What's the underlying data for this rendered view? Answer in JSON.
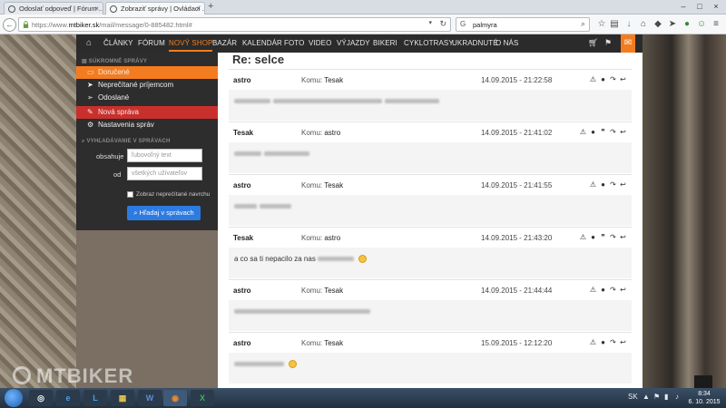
{
  "browser": {
    "tabs": [
      {
        "title": "Odoslať odpoveď | Fórum ..."
      },
      {
        "title": "Zobraziť správy | Ovládací ..."
      }
    ],
    "new_tab": "+",
    "url_prefix": "https://www.",
    "url_domain": "mtbiker.sk",
    "url_path": "/mail/message/0-885482.html#",
    "search_value": "palmyra"
  },
  "site": {
    "nav": [
      "ČLÁNKY",
      "FÓRUM",
      "NOVÝ SHOP",
      "BAZÁR",
      "KALENDÁR",
      "FOTO",
      "VIDEO",
      "VÝJAZDY",
      "BIKERI",
      "CYKLOTRASY",
      "UKRADNUTÉ",
      "O NÁS"
    ],
    "logo": "MTBIKER"
  },
  "sidebar": {
    "section_messages": "SÚKROMNÉ SPRÁVY",
    "items": [
      {
        "label": "Doručené"
      },
      {
        "label": "Neprečítané príjemcom"
      },
      {
        "label": "Odoslané"
      },
      {
        "label": "Nová správa"
      },
      {
        "label": "Nastavenia správ"
      }
    ],
    "section_search": "VYHĽADÁVANIE V SPRÁVACH",
    "contains_label": "obsahuje",
    "contains_placeholder": "ľubovoľný text",
    "from_label": "od",
    "from_placeholder": "všetkých užívateľov",
    "unread_first_label": "Zobraz neprečítané navrchu",
    "search_button": "Hľadaj v správach"
  },
  "main": {
    "title": "Re: selce",
    "to_prefix": "Komu:",
    "messages": [
      {
        "from": "astro",
        "to": "Tesak",
        "date": "14.09.2015 - 21:22:58"
      },
      {
        "from": "Tesak",
        "to": "astro",
        "date": "14.09.2015 - 21:41:02"
      },
      {
        "from": "astro",
        "to": "Tesak",
        "date": "14.09.2015 - 21:41:55"
      },
      {
        "from": "Tesak",
        "to": "astro",
        "date": "14.09.2015 - 21:43:20",
        "visible_text": "a co sa ti nepacilo za nas"
      },
      {
        "from": "astro",
        "to": "Tesak",
        "date": "14.09.2015 - 21:44:44"
      },
      {
        "from": "astro",
        "to": "Tesak",
        "date": "15.09.2015 - 12:12:20"
      }
    ]
  },
  "taskbar": {
    "lang": "SK",
    "time": "8:34",
    "date": "6. 10. 2015"
  },
  "colors": {
    "accent": "#f47c20",
    "danger": "#c9302c",
    "primary": "#2d7be0",
    "dark": "#2d2d2d"
  }
}
